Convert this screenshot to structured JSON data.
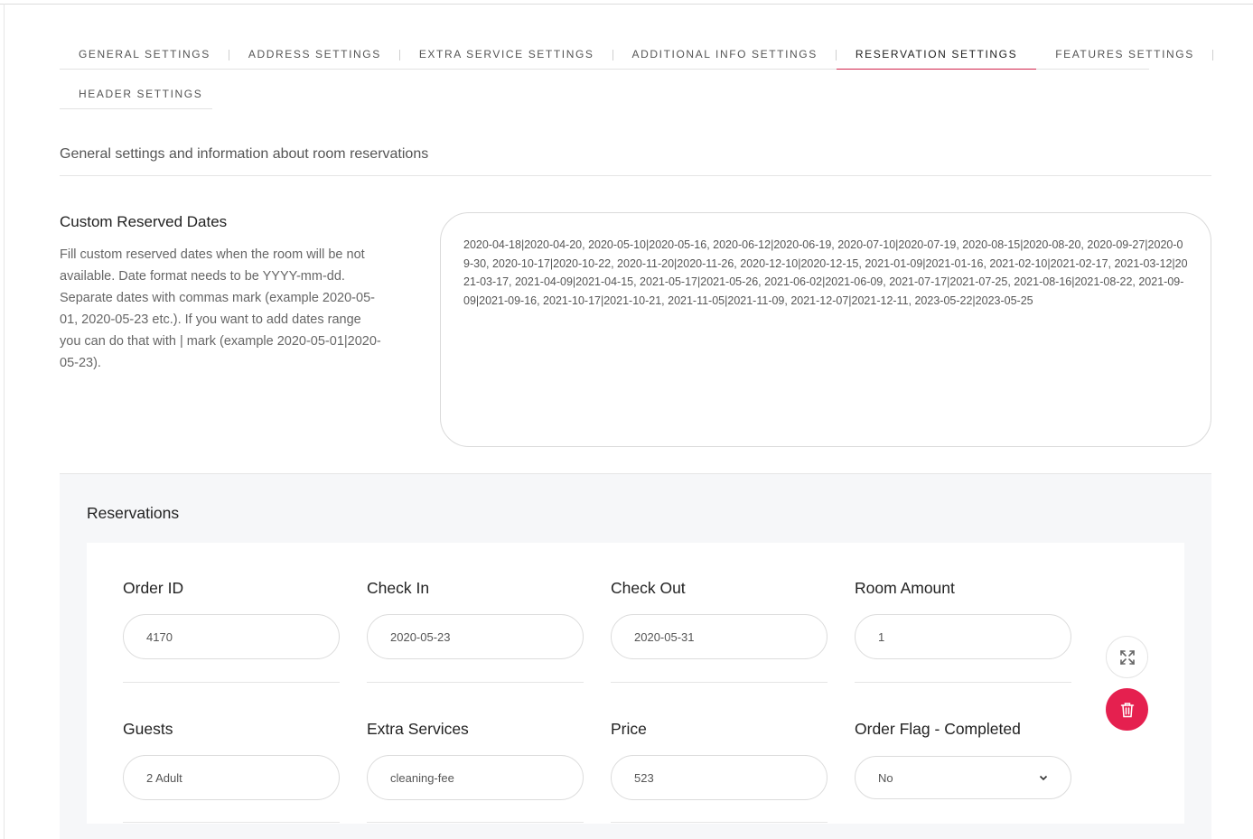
{
  "tabs": [
    {
      "label": "General Settings",
      "active": false
    },
    {
      "label": "Address Settings",
      "active": false
    },
    {
      "label": "Extra Service Settings",
      "active": false
    },
    {
      "label": "Additional Info Settings",
      "active": false
    },
    {
      "label": "Reservation Settings",
      "active": true
    },
    {
      "label": "Features Settings",
      "active": false
    },
    {
      "label": "Header Settings",
      "active": false
    }
  ],
  "section": {
    "title": "General settings and information about room reservations"
  },
  "custom_reserved_dates": {
    "title": "Custom Reserved Dates",
    "description": "Fill custom reserved dates when the room will be not available. Date format needs to be YYYY-mm-dd. Separate dates with commas mark (example 2020-05-01, 2020-05-23 etc.). If you want to add dates range you can do that with | mark (example 2020-05-01|2020-05-23).",
    "value": "2020-04-18|2020-04-20, 2020-05-10|2020-05-16, 2020-06-12|2020-06-19, 2020-07-10|2020-07-19, 2020-08-15|2020-08-20, 2020-09-27|2020-09-30, 2020-10-17|2020-10-22, 2020-11-20|2020-11-26, 2020-12-10|2020-12-15, 2021-01-09|2021-01-16, 2021-02-10|2021-02-17, 2021-03-12|2021-03-17, 2021-04-09|2021-04-15, 2021-05-17|2021-05-26, 2021-06-02|2021-06-09, 2021-07-17|2021-07-25, 2021-08-16|2021-08-22, 2021-09-09|2021-09-16, 2021-10-17|2021-10-21, 2021-11-05|2021-11-09, 2021-12-07|2021-12-11, 2023-05-22|2023-05-25"
  },
  "reservations": {
    "title": "Reservations",
    "order_id": {
      "label": "Order ID",
      "value": "4170"
    },
    "check_in": {
      "label": "Check In",
      "value": "2020-05-23"
    },
    "check_out": {
      "label": "Check Out",
      "value": "2020-05-31"
    },
    "room_amount": {
      "label": "Room Amount",
      "value": "1"
    },
    "guests": {
      "label": "Guests",
      "value": "2 Adult"
    },
    "extra_services": {
      "label": "Extra Services",
      "value": "cleaning-fee"
    },
    "price": {
      "label": "Price",
      "value": "523"
    },
    "order_flag": {
      "label": "Order Flag - Completed",
      "value": "No"
    }
  },
  "icons": {
    "expand": "expand-arrows-icon",
    "delete": "trash-icon",
    "select": "chevron-down-icon"
  },
  "colors": {
    "accent": "#d2224b",
    "delete_button": "#e5204f",
    "panel_bg": "#f6f7f9"
  }
}
